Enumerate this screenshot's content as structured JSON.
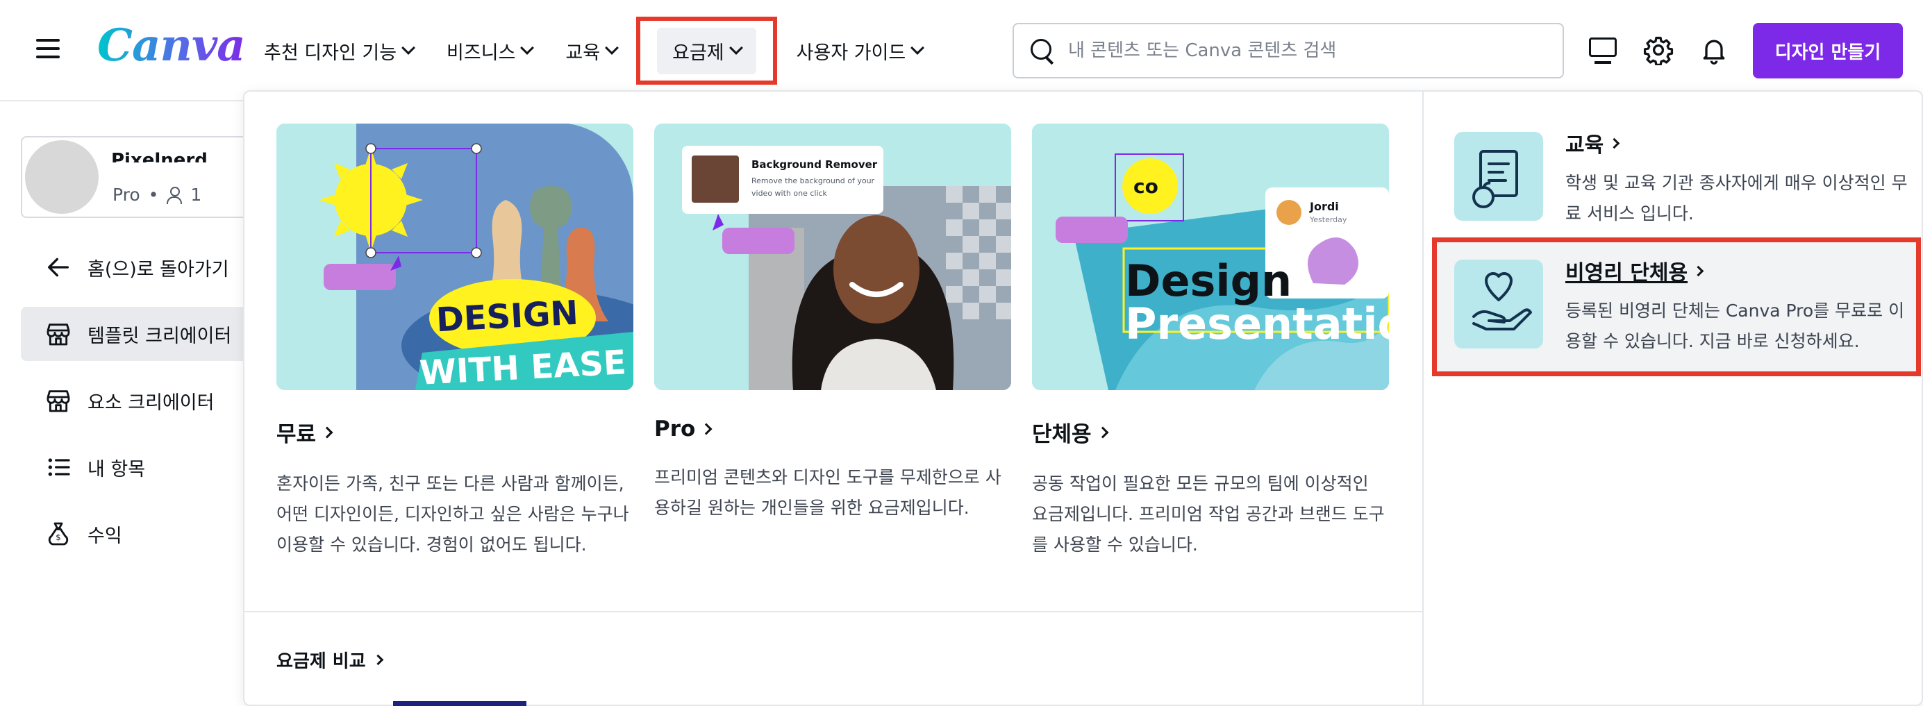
{
  "header": {
    "logo": "Canva",
    "nav": [
      {
        "label": "추천 디자인 기능"
      },
      {
        "label": "비즈니스"
      },
      {
        "label": "교육"
      },
      {
        "label": "요금제"
      },
      {
        "label": "사용자 가이드"
      }
    ],
    "search_placeholder": "내 콘텐츠 또는 Canva 콘텐츠 검색",
    "create_button": "디자인 만들기"
  },
  "sidebar": {
    "profile_name": "Pixelnerd",
    "profile_plan": "Pro",
    "profile_separator": "•",
    "profile_members": "1",
    "items": [
      {
        "label": "홈(으)로 돌아가기",
        "icon": "arrow-left-icon"
      },
      {
        "label": "템플릿 크리에이터",
        "icon": "store-icon"
      },
      {
        "label": "요소 크리에이터",
        "icon": "store-icon"
      },
      {
        "label": "내 항목",
        "icon": "list-icon"
      },
      {
        "label": "수익",
        "icon": "money-bag-icon"
      }
    ]
  },
  "dropdown": {
    "cards": [
      {
        "title": "무료",
        "desc": "혼자이든 가족, 친구 또는 다른 사람과 함께이든, 어떤 디자인이든, 디자인하고 싶은 사람은 누구나 이용할 수 있습니다. 경험이 없어도 됩니다.",
        "img_text_1": "DESIGN",
        "img_text_2": "WITH EASE"
      },
      {
        "title": "Pro",
        "desc": "프리미엄 콘텐츠와 디자인 도구를 무제한으로 사용하길 원하는 개인들을 위한 요금제입니다.",
        "img_popup_title": "Background Remover",
        "img_popup_sub": "Remove the background of your video with one click"
      },
      {
        "title": "단체용",
        "desc": "공동 작업이 필요한 모든 규모의 팀에 이상적인 요금제입니다. 프리미엄 작업 공간과 브랜드 도구를 사용할 수 있습니다.",
        "img_text_1": "Design",
        "img_text_2": "Presentatio",
        "img_user": "Jordi",
        "img_user_sub": "Yesterday",
        "img_badge": "co"
      }
    ],
    "compare_link": "요금제 비교",
    "side_cards": [
      {
        "title": "교육",
        "desc": "학생 및 교육 기관 종사자에게 매우 이상적인 무료 서비스 입니다."
      },
      {
        "title": "비영리 단체용",
        "desc": "등록된 비영리 단체는 Canva Pro를 무료로 이용할 수 있습니다. 지금 바로 신청하세요."
      }
    ]
  },
  "colors": {
    "brand_purple": "#7d2ae8",
    "highlight_red": "#e5392b",
    "teal_bg": "#b8eaea"
  }
}
